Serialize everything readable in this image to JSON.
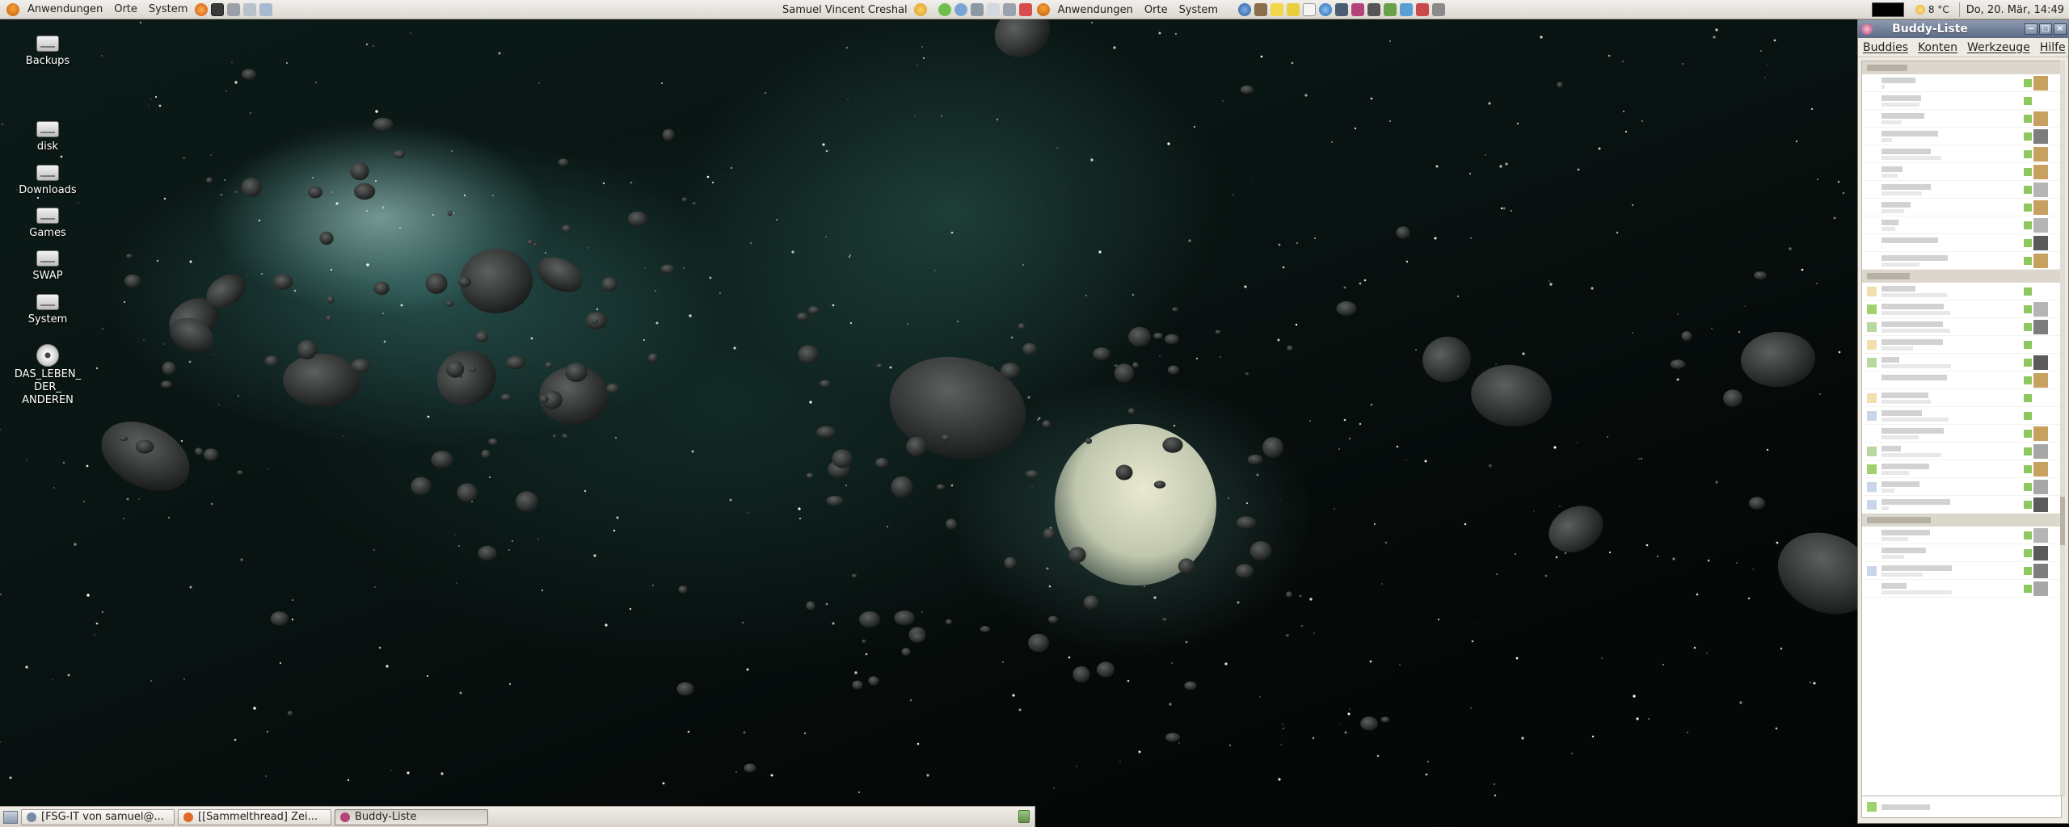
{
  "top_panel": {
    "left_menus": [
      {
        "label": "Anwendungen"
      },
      {
        "label": "Orte"
      },
      {
        "label": "System"
      }
    ],
    "user_name": "Samuel Vincent Creshal",
    "right_menus": [
      {
        "label": "Anwendungen"
      },
      {
        "label": "Orte"
      },
      {
        "label": "System"
      }
    ],
    "weather": "8 °C",
    "clock": "Do, 20. Mär, 14:49"
  },
  "desktop": {
    "icons": [
      {
        "label": "Backups",
        "icon": "drive-icon"
      },
      {
        "label": "disk",
        "icon": "drive-icon"
      },
      {
        "label": "Downloads",
        "icon": "drive-icon"
      },
      {
        "label": "Games",
        "icon": "drive-icon"
      },
      {
        "label": "SWAP",
        "icon": "drive-icon"
      },
      {
        "label": "System",
        "icon": "drive-icon"
      },
      {
        "label": "DAS_LEBEN_\nDER_\nANDEREN",
        "icon": "cd-icon"
      }
    ]
  },
  "buddy_window": {
    "title": "Buddy-Liste",
    "menu": [
      "Buddies",
      "Konten",
      "Werkzeuge",
      "Hilfe"
    ],
    "window_controls": [
      "minimize-icon",
      "maximize-icon",
      "close-icon"
    ]
  },
  "taskbar": {
    "tasks": [
      {
        "label": "[FSG-IT von samuel@...",
        "active": false,
        "color": "#7a8aa2"
      },
      {
        "label": "[[Sammelthread] Zei...",
        "active": false,
        "color": "#e06a28"
      },
      {
        "label": "Buddy-Liste",
        "active": true,
        "color": "#b6427a"
      }
    ]
  },
  "colors": {
    "panel": "#dcd8d0",
    "titlebar": "#5b6b86",
    "online_status": "#9fd26d"
  }
}
